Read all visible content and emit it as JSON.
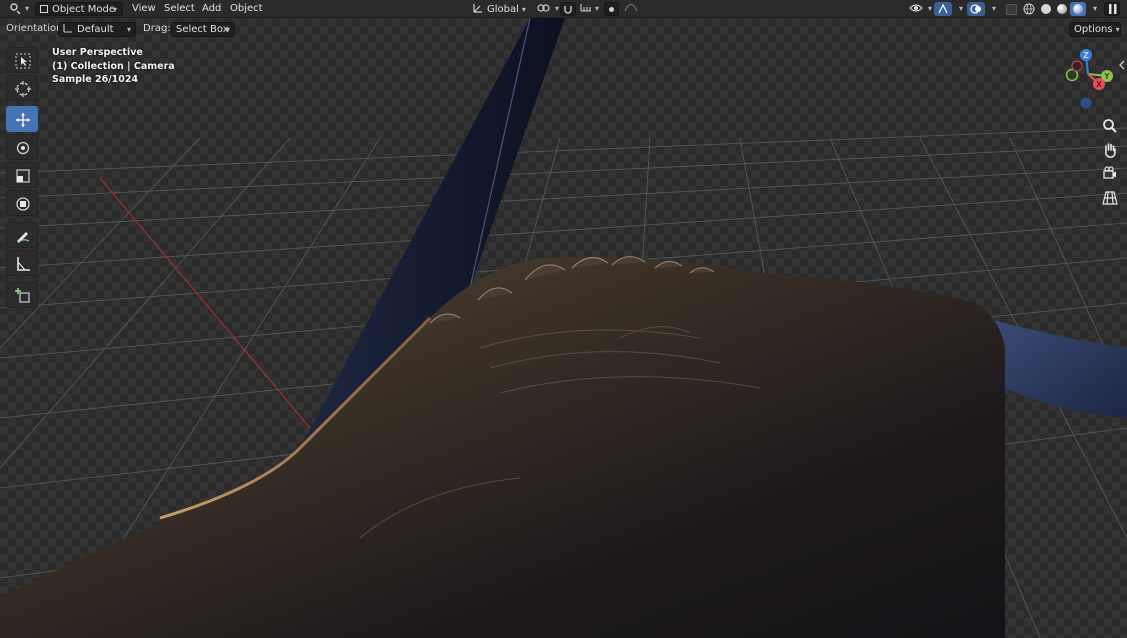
{
  "header": {
    "editor_icon": "viewport-editor-icon",
    "mode": "Object Mode",
    "menus": [
      "View",
      "Select",
      "Add",
      "Object"
    ],
    "transform_orientation": "Global",
    "snap_icon": "magnet-icon",
    "proportional_icon": "proportional-edit-icon"
  },
  "subbar": {
    "orientation_label": "Orientation:",
    "orientation_value": "Default",
    "drag_label": "Drag:",
    "drag_value": "Select Box",
    "options_label": "Options"
  },
  "overlay": {
    "perspective": "User Perspective",
    "collection": "(1) Collection | Camera",
    "sample": "Sample 26/1024"
  },
  "gizmo": {
    "x_label": "X",
    "y_label": "Y",
    "z_label": "Z"
  },
  "tools": [
    "select-box-tool",
    "cursor-tool",
    "move-tool",
    "rotate-tool",
    "scale-tool",
    "transform-tool",
    "annotate-tool",
    "measure-tool",
    "add-cube-tool"
  ],
  "colors": {
    "accent": "#4772b3",
    "x_axis": "#e84d5e",
    "y_axis": "#8bc34a",
    "z_axis": "#3b82d6"
  }
}
